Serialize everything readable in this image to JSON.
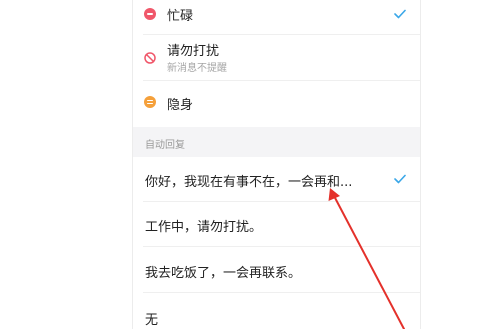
{
  "status_options": [
    {
      "label": "忙碌",
      "icon": "busy-status-icon",
      "color": "#f0576a",
      "selected": true
    },
    {
      "label": "请勿打扰",
      "sublabel": "新消息不提醒",
      "icon": "do-not-disturb-icon",
      "color": "#f0576a",
      "selected": false
    },
    {
      "label": "隐身",
      "icon": "invisible-status-icon",
      "color": "#f5a03b",
      "selected": false
    }
  ],
  "auto_reply": {
    "section_title": "自动回复",
    "options": [
      {
        "text": "你好，我现在有事不在，一会再和...",
        "selected": true
      },
      {
        "text": "工作中，请勿打扰。",
        "selected": false
      },
      {
        "text": "我去吃饭了，一会再联系。",
        "selected": false
      },
      {
        "text": "无",
        "selected": false
      }
    ]
  },
  "colors": {
    "check": "#3aa7e8",
    "arrow": "#e4312b"
  }
}
